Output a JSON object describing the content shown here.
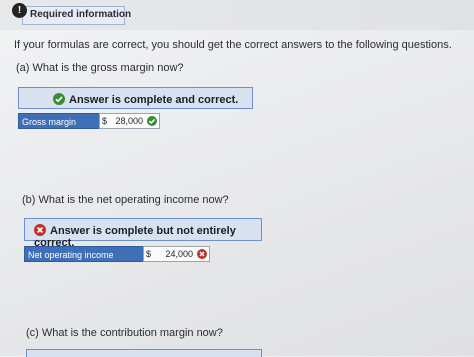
{
  "header": {
    "badge": "!",
    "title": "Required information"
  },
  "intro_text": "If your formulas are correct, you should get the correct answers to the following questions.",
  "questions": [
    {
      "prompt": "(a) What is the gross margin now?",
      "status": "Answer is complete and correct.",
      "status_icon": "check-circle-icon",
      "status_color": "#3a8a3a",
      "row": {
        "label": "Gross margin",
        "currency": "$",
        "value": "28,000",
        "result_icon": "check-circle-icon"
      }
    },
    {
      "prompt": "(b) What is the net operating income now?",
      "status": "Answer is complete but not entirely correct.",
      "status_icon": "x-circle-icon",
      "status_color": "#c0312b",
      "row": {
        "label": "Net operating income",
        "currency": "$",
        "value": "24,000",
        "result_icon": "x-circle-icon"
      }
    },
    {
      "prompt": "(c) What is the contribution margin now?"
    }
  ],
  "colors": {
    "accent_blue": "#3f6fb6",
    "banner_bg": "#d8e1ef",
    "correct_green": "#3a8a3a",
    "incorrect_red": "#c0312b"
  }
}
